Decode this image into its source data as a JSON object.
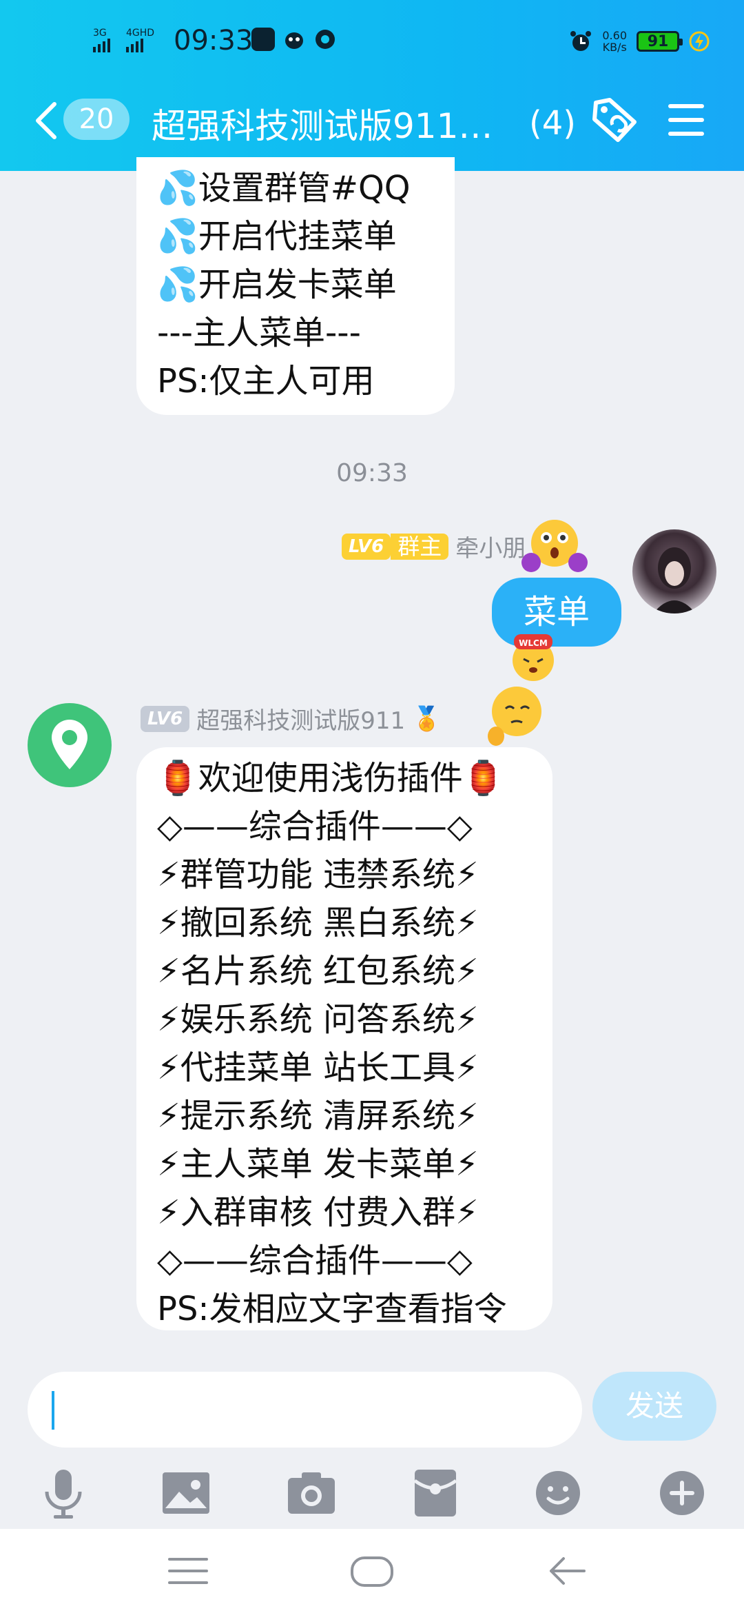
{
  "status_bar": {
    "network1": "3G",
    "network2": "4GHD",
    "time": "09:33",
    "speed_value": "0.60",
    "speed_unit": "KB/s",
    "battery": "91"
  },
  "navbar": {
    "unread": "20",
    "title": "超强科技测试版911…",
    "member_count": "(4)"
  },
  "messages": {
    "top_bubble_lines": [
      "💦设置群管#QQ",
      "💦开启代挂菜单",
      "💦开启发卡菜单",
      "---主人菜单---",
      "PS:仅主人可用"
    ],
    "timestamp": "09:33",
    "me": {
      "level": "LV6",
      "role": "群主",
      "name": "牵小朋…手",
      "text": "菜单"
    },
    "bot": {
      "level": "LV6",
      "name": "超强科技测试版911",
      "medal": "🏅",
      "lines": [
        "🏮欢迎使用浅伤插件🏮",
        "◇——综合插件——◇",
        "⚡群管功能 违禁系统⚡",
        "⚡撤回系统 黑白系统⚡",
        "⚡名片系统 红包系统⚡",
        "⚡娱乐系统 问答系统⚡",
        "⚡代挂菜单 站长工具⚡",
        "⚡提示系统 清屏系统⚡",
        "⚡主人菜单 发卡菜单⚡",
        "⚡入群审核 付费入群⚡",
        "◇——综合插件——◇",
        "PS:发相应文字查看指令"
      ]
    }
  },
  "input": {
    "value": "",
    "send_label": "发送"
  },
  "colors": {
    "header": "#13c8ef",
    "accent": "#2bb1f7",
    "bot_avatar": "#3fc47a"
  }
}
